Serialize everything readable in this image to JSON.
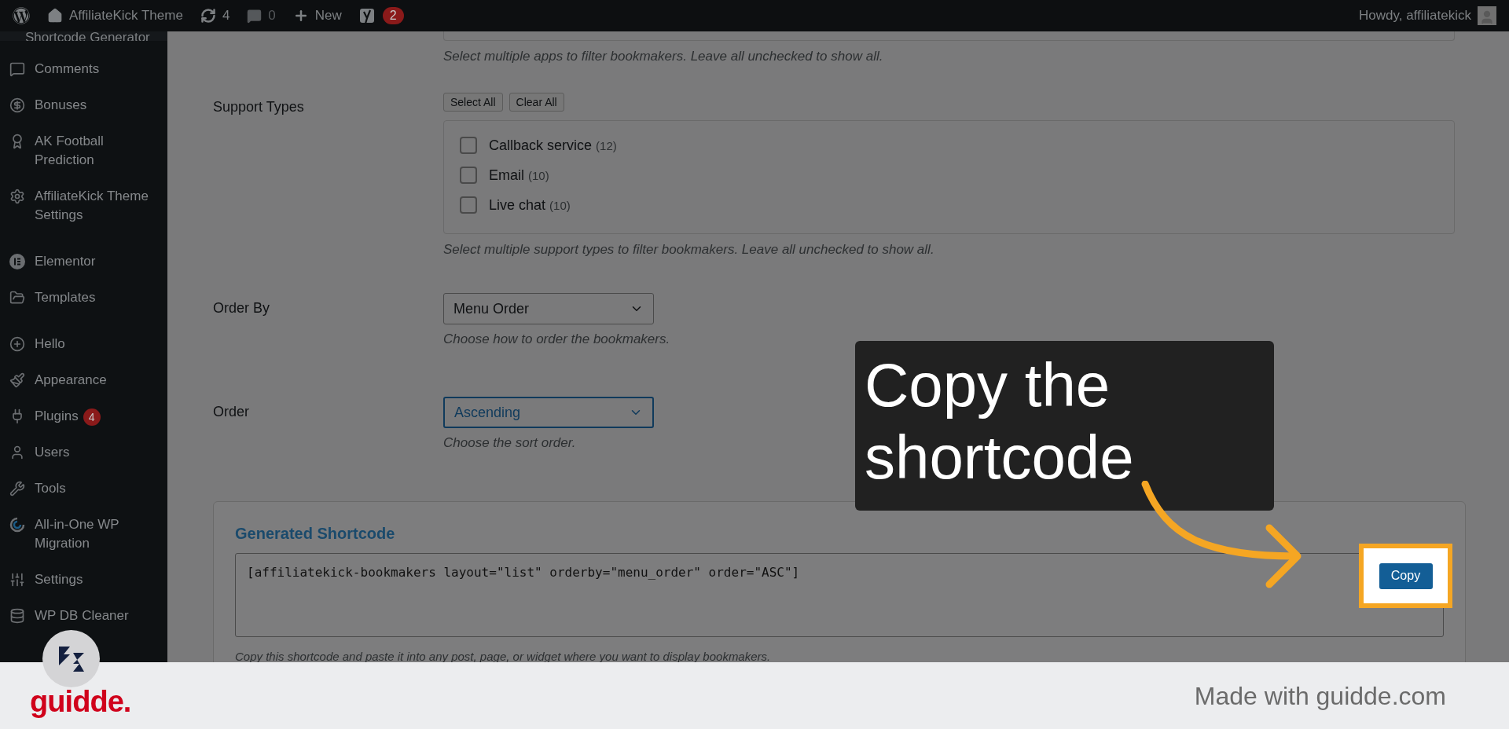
{
  "admin_bar": {
    "items": [
      {
        "kind": "logo"
      },
      {
        "kind": "site",
        "label": "AffiliateKick Theme"
      },
      {
        "kind": "updates",
        "label": "4"
      },
      {
        "kind": "comments",
        "label": "0"
      },
      {
        "kind": "new",
        "label": "New"
      },
      {
        "kind": "yoast",
        "badge": "2"
      }
    ],
    "greeting": "Howdy, affiliatekick"
  },
  "sidebar": {
    "current": "Shortcode Generator",
    "groups": [
      [
        {
          "label": "Comments"
        },
        {
          "label": "Bonuses"
        },
        {
          "label": "AK Football Prediction"
        },
        {
          "label": "AffiliateKick Theme Settings"
        }
      ],
      [
        {
          "label": "Elementor"
        },
        {
          "label": "Templates"
        }
      ],
      [
        {
          "label": "Hello"
        },
        {
          "label": "Appearance"
        },
        {
          "label": "Plugins",
          "badge": "4"
        },
        {
          "label": "Users"
        },
        {
          "label": "Tools"
        },
        {
          "label": "All-in-One WP Migration"
        },
        {
          "label": "Settings"
        },
        {
          "label": "WP DB Cleaner"
        }
      ]
    ]
  },
  "apps_help": "Select multiple apps to filter bookmakers. Leave all unchecked to show all.",
  "support_types": {
    "label": "Support Types",
    "buttons": [
      "Select All",
      "Clear All"
    ],
    "options": [
      {
        "label": "Callback service",
        "count": "(12)",
        "checked": false
      },
      {
        "label": "Email",
        "count": "(10)",
        "checked": false
      },
      {
        "label": "Live chat",
        "count": "(10)",
        "checked": false
      }
    ],
    "help": "Select multiple support types to filter bookmakers. Leave all unchecked to show all."
  },
  "selects": [
    {
      "label": "Order By",
      "value": "Menu Order",
      "focused": false,
      "help": "Choose how to order the bookmakers."
    },
    {
      "label": "Order",
      "value": "Ascending",
      "focused": true,
      "help": "Choose the sort order."
    }
  ],
  "generated": {
    "title": "Generated Shortcode",
    "shortcode": "[affiliatekick-bookmakers layout=\"list\" orderby=\"menu_order\" order=\"ASC\"]",
    "copy_button": "Copy",
    "help": "Copy this shortcode and paste it into any post, page, or widget where you want to display bookmakers."
  },
  "callout": {
    "text": "Copy the shortcode"
  },
  "footer": {
    "brand": "guidde.",
    "credit": "Made with guidde.com"
  }
}
